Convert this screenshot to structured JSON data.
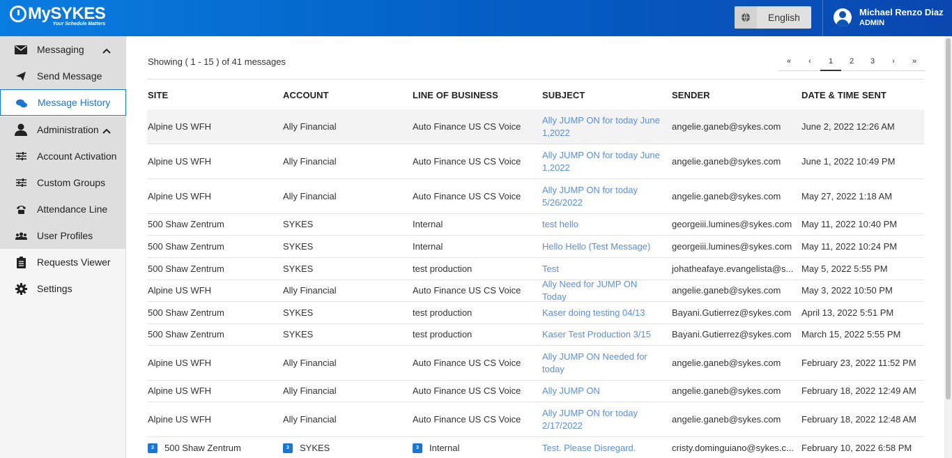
{
  "header": {
    "logo_text": "MySYKES",
    "logo_tagline": "Your Schedule Matters",
    "language": "English",
    "user_name": "Michael Renzo Diaz",
    "user_role": "ADMIN"
  },
  "sidebar": {
    "items": [
      {
        "label": "Messaging",
        "icon": "envelope-icon"
      },
      {
        "label": "Send Message",
        "icon": "send-icon"
      },
      {
        "label": "Message History",
        "icon": "chat-bubbles-icon"
      },
      {
        "label": "Administration",
        "icon": "person-icon"
      },
      {
        "label": "Account Activation",
        "icon": "sliders-icon"
      },
      {
        "label": "Custom Groups",
        "icon": "sliders-icon"
      },
      {
        "label": "Attendance Line",
        "icon": "phone-icon"
      },
      {
        "label": "User Profiles",
        "icon": "users-icon"
      },
      {
        "label": "Requests Viewer",
        "icon": "clipboard-icon"
      },
      {
        "label": "Settings",
        "icon": "gear-icon"
      }
    ]
  },
  "main": {
    "showing": "Showing ( 1 - 15 ) of 41 messages",
    "pagination": {
      "first": "«",
      "prev": "‹",
      "pages": [
        "1",
        "2",
        "3"
      ],
      "current": "1",
      "next": "›",
      "last": "»"
    },
    "columns": [
      "SITE",
      "ACCOUNT",
      "LINE OF BUSINESS",
      "SUBJECT",
      "SENDER",
      "DATE & TIME SENT"
    ],
    "rows": [
      {
        "site": "Alpine US WFH",
        "account": "Ally Financial",
        "lob": "Auto Finance US CS Voice",
        "subject": "Ally JUMP ON for today June 1,2022",
        "sender": "angelie.ganeb@sykes.com",
        "date": "June 2, 2022 12:26 AM"
      },
      {
        "site": "Alpine US WFH",
        "account": "Ally Financial",
        "lob": "Auto Finance US CS Voice",
        "subject": "Ally JUMP ON for today June 1,2022",
        "sender": "angelie.ganeb@sykes.com",
        "date": "June 1, 2022 10:49 PM"
      },
      {
        "site": "Alpine US WFH",
        "account": "Ally Financial",
        "lob": "Auto Finance US CS Voice",
        "subject": "Ally JUMP ON for today 5/26/2022",
        "sender": "angelie.ganeb@sykes.com",
        "date": "May 27, 2022 1:18 AM"
      },
      {
        "site": "500 Shaw Zentrum",
        "account": "SYKES",
        "lob": "Internal",
        "subject": "test hello",
        "sender": "georgeiii.lumines@sykes.com",
        "date": "May 11, 2022 10:40 PM"
      },
      {
        "site": "500 Shaw Zentrum",
        "account": "SYKES",
        "lob": "Internal",
        "subject": "Hello Hello (Test Message)",
        "sender": "georgeiii.lumines@sykes.com",
        "date": "May 11, 2022 10:24 PM"
      },
      {
        "site": "500 Shaw Zentrum",
        "account": "SYKES",
        "lob": "test production",
        "subject": "Test",
        "sender": "johatheafaye.evangelista@s...",
        "date": "May 5, 2022 5:55 PM"
      },
      {
        "site": "Alpine US WFH",
        "account": "Ally Financial",
        "lob": "Auto Finance US CS Voice",
        "subject": "Ally Need for JUMP ON Today",
        "sender": "angelie.ganeb@sykes.com",
        "date": "May 3, 2022 10:50 PM"
      },
      {
        "site": "500 Shaw Zentrum",
        "account": "SYKES",
        "lob": "test production",
        "subject": "Kaser doing testing 04/13",
        "sender": "Bayani.Gutierrez@sykes.com",
        "date": "April 13, 2022 5:51 PM"
      },
      {
        "site": "500 Shaw Zentrum",
        "account": "SYKES",
        "lob": "test production",
        "subject": "Kaser Test Production 3/15",
        "sender": "Bayani.Gutierrez@sykes.com",
        "date": "March 15, 2022 5:55 PM"
      },
      {
        "site": "Alpine US WFH",
        "account": "Ally Financial",
        "lob": "Auto Finance US CS Voice",
        "subject": "Ally JUMP ON Needed for today",
        "sender": "angelie.ganeb@sykes.com",
        "date": "February 23, 2022 11:52 PM"
      },
      {
        "site": "Alpine US WFH",
        "account": "Ally Financial",
        "lob": "Auto Finance US CS Voice",
        "subject": "Ally JUMP ON",
        "sender": "angelie.ganeb@sykes.com",
        "date": "February 18, 2022 12:49 AM"
      },
      {
        "site": "Alpine US WFH",
        "account": "Ally Financial",
        "lob": "Auto Finance US CS Voice",
        "subject": "Ally JUMP ON for today 2/17/2022",
        "sender": "angelie.ganeb@sykes.com",
        "date": "February 18, 2022 12:48 AM"
      },
      {
        "site": "500 Shaw Zentrum",
        "account": "SYKES",
        "lob": "Internal",
        "subject": "Test. Please Disregard.",
        "sender": "cristy.dominguiano@sykes.c...",
        "date": "February 10, 2022 6:58 PM",
        "count": "3"
      }
    ]
  },
  "colors": {
    "header_start": "#0a7de0",
    "header_end": "#0a47b0",
    "accent": "#1976d2",
    "link": "#5b8fd6"
  }
}
